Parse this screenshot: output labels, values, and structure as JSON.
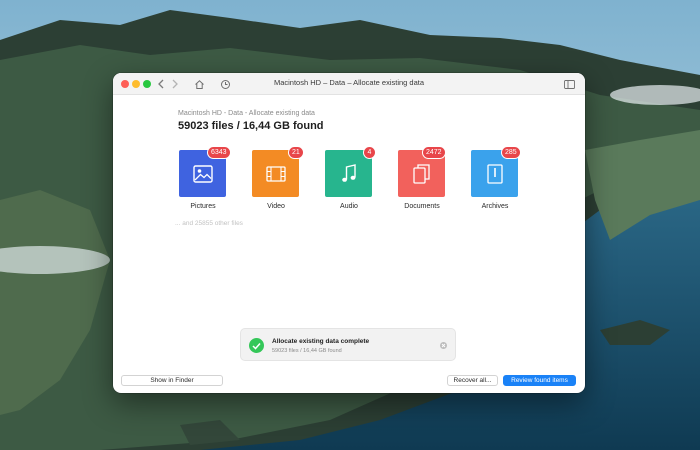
{
  "window": {
    "title": "Macintosh HD – Data – Allocate existing data"
  },
  "content": {
    "breadcrumb": "Macintosh HD - Data - Allocate existing data",
    "summary": "59023 files / 16,44 GB found",
    "other_files": "... and 25855 other files"
  },
  "categories": [
    {
      "label": "Pictures",
      "count": "6343",
      "color": "#3f63e0",
      "icon": "image-icon"
    },
    {
      "label": "Video",
      "count": "21",
      "color": "#f38b24",
      "icon": "film-icon"
    },
    {
      "label": "Audio",
      "count": "4",
      "color": "#27b58e",
      "icon": "music-note-icon"
    },
    {
      "label": "Documents",
      "count": "2472",
      "color": "#f2615c",
      "icon": "documents-icon"
    },
    {
      "label": "Archives",
      "count": "285",
      "color": "#3aa2ec",
      "icon": "archive-icon"
    }
  ],
  "notification": {
    "title": "Allocate existing data complete",
    "subtitle": "59023 files / 16,44 GB found"
  },
  "toolbar": {
    "show_in_finder": "Show in Finder",
    "recover_all": "Recover all...",
    "review_found": "Review found items"
  },
  "colors": {
    "accent": "#1a82f7",
    "badge": "#e8464a",
    "success": "#34c759"
  }
}
